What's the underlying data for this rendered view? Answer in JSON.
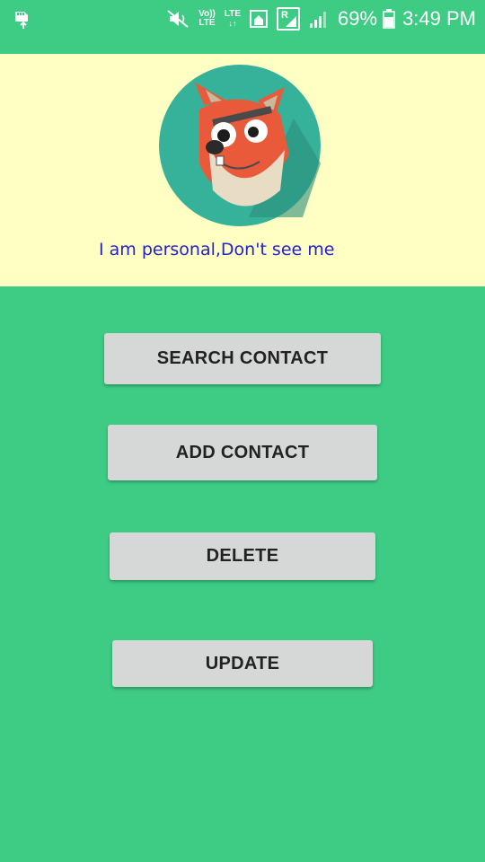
{
  "status_bar": {
    "left_icon": "sd-card-upload-icon",
    "icons": [
      "mute-icon",
      "volte-icon",
      "lte-data-icon",
      "home-icon",
      "roaming-signal-icon",
      "signal-icon",
      "battery-icon"
    ],
    "volte_label_top": "Vo))",
    "volte_label_bottom": "LTE",
    "lte_label": "LTE",
    "roaming_label": "R",
    "battery_percent": "69%",
    "time": "3:49 PM"
  },
  "header": {
    "avatar_icon": "fox-avatar-icon",
    "tagline": "I am personal,Don't see me"
  },
  "buttons": {
    "search": "SEARCH CONTACT",
    "add": "ADD CONTACT",
    "delete": "DELETE",
    "update": "UPDATE"
  },
  "colors": {
    "background": "#3ecb84",
    "header_bg": "#ffffc4",
    "tagline": "#2323c8",
    "button_bg": "#d6d7d7",
    "button_text": "#222222"
  }
}
